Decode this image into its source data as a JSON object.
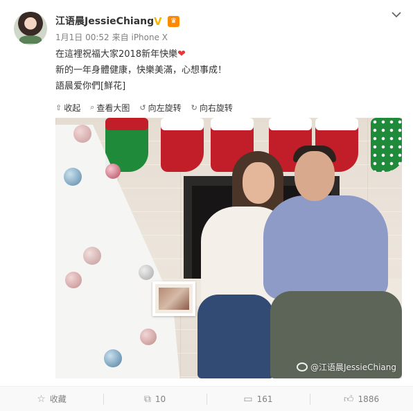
{
  "user": {
    "name": "江语晨JessieChiang",
    "verified_badge": "V"
  },
  "meta": {
    "timestamp": "1月1日 00:52",
    "source": "来自 iPhone X"
  },
  "post": {
    "line1": "在這裡祝福大家2018新年快樂",
    "line1_emoji": "❤",
    "line2": "新的一年身體健康，快樂美滿，心想事成！",
    "line3": "語晨爱你們[鮮花]"
  },
  "toolbar": {
    "collapse": "收起",
    "view_large": "查看大图",
    "rotate_left": "向左旋转",
    "rotate_right": "向右旋转"
  },
  "photo": {
    "watermark": "@江语晨JessieChiang"
  },
  "footer": {
    "favorite": "收藏",
    "repost_count": "10",
    "comment_count": "161",
    "like_count": "1886"
  },
  "colors": {
    "accent_gold": "#f7b500",
    "heart": "#e8383c",
    "text_muted": "#808080"
  }
}
